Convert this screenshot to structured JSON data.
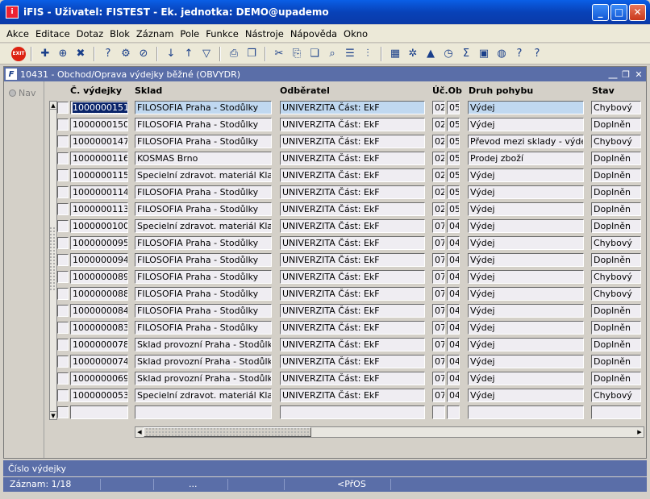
{
  "window": {
    "title": "iFIS - Uživatel: FISTEST - Ek. jednotka: DEMO@upademo",
    "app_icon": "ifis-app-icon"
  },
  "menu": [
    "Akce",
    "Editace",
    "Dotaz",
    "Blok",
    "Záznam",
    "Pole",
    "Funkce",
    "Nástroje",
    "Nápověda",
    "Okno"
  ],
  "toolbar": {
    "exit_label": "EXIT"
  },
  "form": {
    "title": "10431 - Obchod/Oprava výdejky běžné (OBVYDR)",
    "nav_label": "Nav",
    "columns": {
      "cislo": "Č. výdejky",
      "sklad": "Sklad",
      "odberatel": "Odběratel",
      "ucob": "Úč.Ob",
      "druh": "Druh pohybu",
      "stav": "Stav"
    },
    "rows": [
      {
        "cislo": "1000000151",
        "sklad": "FILOSOFIA Praha - Stodůlky",
        "odberatel": "UNIVERZITA Část: EkF",
        "uc": "02",
        "ob": "05",
        "druh": "Výdej",
        "stav": "Chybový"
      },
      {
        "cislo": "1000000150",
        "sklad": "FILOSOFIA Praha - Stodůlky",
        "odberatel": "UNIVERZITA Část: EkF",
        "uc": "02",
        "ob": "05",
        "druh": "Výdej",
        "stav": "Doplněn"
      },
      {
        "cislo": "1000000147",
        "sklad": "FILOSOFIA Praha - Stodůlky",
        "odberatel": "UNIVERZITA Část: EkF",
        "uc": "02",
        "ob": "05",
        "druh": "Převod mezi sklady - výdej",
        "stav": "Chybový"
      },
      {
        "cislo": "1000000116",
        "sklad": "KOSMAS Brno",
        "odberatel": "UNIVERZITA Část: EkF",
        "uc": "02",
        "ob": "05",
        "druh": "Prodej zboží",
        "stav": "Doplněn"
      },
      {
        "cislo": "1000000115",
        "sklad": "Specielní zdravot. materiál Kladno",
        "odberatel": "UNIVERZITA Část: EkF",
        "uc": "02",
        "ob": "05",
        "druh": "Výdej",
        "stav": "Doplněn"
      },
      {
        "cislo": "1000000114",
        "sklad": "FILOSOFIA Praha - Stodůlky",
        "odberatel": "UNIVERZITA Část: EkF",
        "uc": "02",
        "ob": "05",
        "druh": "Výdej",
        "stav": "Doplněn"
      },
      {
        "cislo": "1000000113",
        "sklad": "FILOSOFIA Praha - Stodůlky",
        "odberatel": "UNIVERZITA Část: EkF",
        "uc": "02",
        "ob": "05",
        "druh": "Výdej",
        "stav": "Doplněn"
      },
      {
        "cislo": "1000000100",
        "sklad": "Specielní zdravot. materiál Kladno",
        "odberatel": "UNIVERZITA Část: EkF",
        "uc": "07",
        "ob": "04",
        "druh": "Výdej",
        "stav": "Doplněn"
      },
      {
        "cislo": "1000000095",
        "sklad": "FILOSOFIA Praha - Stodůlky",
        "odberatel": "UNIVERZITA Část: EkF",
        "uc": "07",
        "ob": "04",
        "druh": "Výdej",
        "stav": "Chybový"
      },
      {
        "cislo": "1000000094",
        "sklad": "FILOSOFIA Praha - Stodůlky",
        "odberatel": "UNIVERZITA Část: EkF",
        "uc": "07",
        "ob": "04",
        "druh": "Výdej",
        "stav": "Doplněn"
      },
      {
        "cislo": "1000000089",
        "sklad": "FILOSOFIA Praha - Stodůlky",
        "odberatel": "UNIVERZITA Část: EkF",
        "uc": "07",
        "ob": "04",
        "druh": "Výdej",
        "stav": "Chybový"
      },
      {
        "cislo": "1000000088",
        "sklad": "FILOSOFIA Praha - Stodůlky",
        "odberatel": "UNIVERZITA Část: EkF",
        "uc": "07",
        "ob": "04",
        "druh": "Výdej",
        "stav": "Chybový"
      },
      {
        "cislo": "1000000084",
        "sklad": "FILOSOFIA Praha - Stodůlky",
        "odberatel": "UNIVERZITA Část: EkF",
        "uc": "07",
        "ob": "04",
        "druh": "Výdej",
        "stav": "Doplněn"
      },
      {
        "cislo": "1000000083",
        "sklad": "FILOSOFIA Praha - Stodůlky",
        "odberatel": "UNIVERZITA Část: EkF",
        "uc": "07",
        "ob": "04",
        "druh": "Výdej",
        "stav": "Doplněn"
      },
      {
        "cislo": "1000000078",
        "sklad": "Sklad provozní Praha - Stodůlky",
        "odberatel": "UNIVERZITA Část: EkF",
        "uc": "07",
        "ob": "04",
        "druh": "Výdej",
        "stav": "Doplněn"
      },
      {
        "cislo": "1000000074",
        "sklad": "Sklad provozní Praha - Stodůlky",
        "odberatel": "UNIVERZITA Část: EkF",
        "uc": "07",
        "ob": "04",
        "druh": "Výdej",
        "stav": "Doplněn"
      },
      {
        "cislo": "1000000069",
        "sklad": "Sklad provozní Praha - Stodůlky",
        "odberatel": "UNIVERZITA Část: EkF",
        "uc": "07",
        "ob": "04",
        "druh": "Výdej",
        "stav": "Doplněn"
      },
      {
        "cislo": "1000000053",
        "sklad": "Specielní zdravot. materiál Kladno",
        "odberatel": "UNIVERZITA Část: EkF",
        "uc": "07",
        "ob": "04",
        "druh": "Výdej",
        "stav": "Chybový"
      },
      {
        "cislo": "",
        "sklad": "",
        "odberatel": "",
        "uc": "",
        "ob": "",
        "druh": "",
        "stav": ""
      }
    ]
  },
  "hint": "Číslo výdejky",
  "status": {
    "record": "Záznam: 1/18",
    "ellipsis": "...",
    "mode": "<PřOS"
  }
}
